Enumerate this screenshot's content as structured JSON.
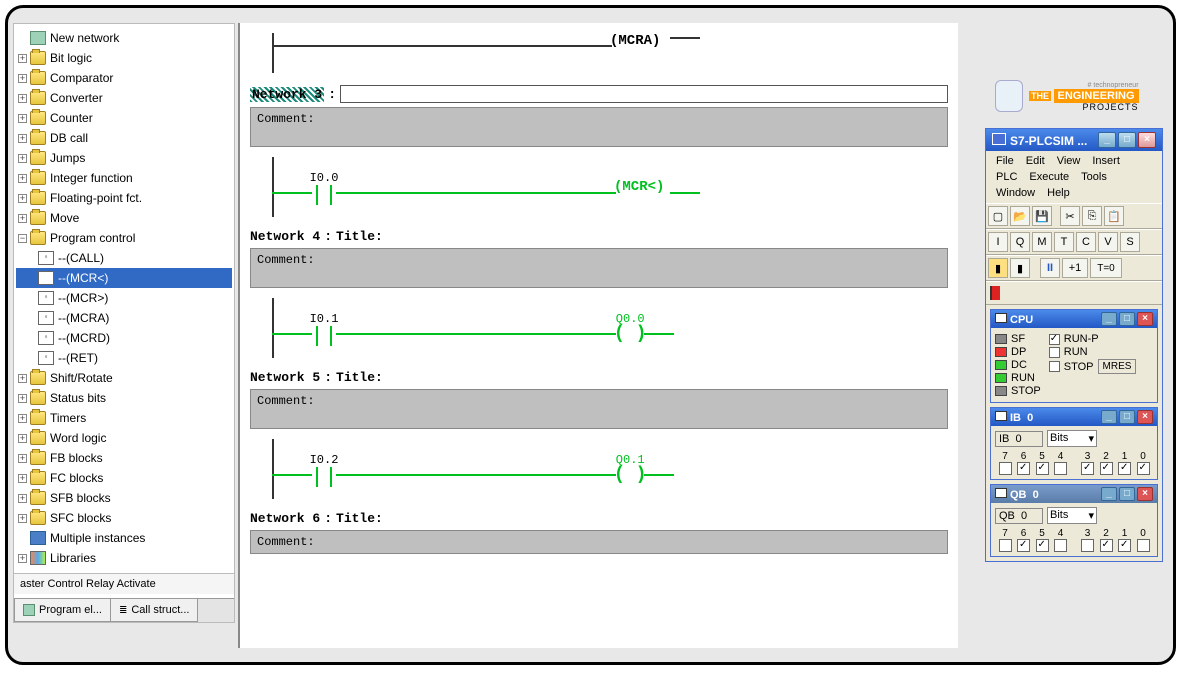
{
  "tree": {
    "items": [
      {
        "label": "New network",
        "icon": "prog",
        "indent": 0
      },
      {
        "label": "Bit logic",
        "icon": "folder",
        "indent": 0,
        "exp": "+"
      },
      {
        "label": "Comparator",
        "icon": "folder",
        "indent": 0,
        "exp": "+"
      },
      {
        "label": "Converter",
        "icon": "folder",
        "indent": 0,
        "exp": "+"
      },
      {
        "label": "Counter",
        "icon": "folder",
        "indent": 0,
        "exp": "+"
      },
      {
        "label": "DB call",
        "icon": "folder",
        "indent": 0,
        "exp": "+"
      },
      {
        "label": "Jumps",
        "icon": "folder",
        "indent": 0,
        "exp": "+"
      },
      {
        "label": "Integer function",
        "icon": "folder",
        "indent": 0,
        "exp": "+"
      },
      {
        "label": "Floating-point fct.",
        "icon": "folder",
        "indent": 0,
        "exp": "+"
      },
      {
        "label": "Move",
        "icon": "folder",
        "indent": 0,
        "exp": "+"
      },
      {
        "label": "Program control",
        "icon": "folder",
        "indent": 0,
        "exp": "−"
      },
      {
        "label": "--(CALL)",
        "icon": "element",
        "indent": 1
      },
      {
        "label": "--(MCR<)",
        "icon": "element",
        "indent": 1,
        "selected": true
      },
      {
        "label": "--(MCR>)",
        "icon": "element",
        "indent": 1
      },
      {
        "label": "--(MCRA)",
        "icon": "element",
        "indent": 1
      },
      {
        "label": "--(MCRD)",
        "icon": "element",
        "indent": 1
      },
      {
        "label": "--(RET)",
        "icon": "element",
        "indent": 1
      },
      {
        "label": "Shift/Rotate",
        "icon": "folder",
        "indent": 0,
        "exp": "+"
      },
      {
        "label": "Status bits",
        "icon": "folder",
        "indent": 0,
        "exp": "+"
      },
      {
        "label": "Timers",
        "icon": "folder",
        "indent": 0,
        "exp": "+"
      },
      {
        "label": "Word logic",
        "icon": "folder",
        "indent": 0,
        "exp": "+"
      },
      {
        "label": "FB blocks",
        "icon": "folder",
        "indent": 0,
        "exp": "+"
      },
      {
        "label": "FC blocks",
        "icon": "folder",
        "indent": 0,
        "exp": "+"
      },
      {
        "label": "SFB blocks",
        "icon": "folder",
        "indent": 0,
        "exp": "+"
      },
      {
        "label": "SFC blocks",
        "icon": "folder",
        "indent": 0,
        "exp": "+"
      },
      {
        "label": "Multiple instances",
        "icon": "blue",
        "indent": 0
      },
      {
        "label": "Libraries",
        "icon": "lib",
        "indent": 0,
        "exp": "+"
      }
    ],
    "status": "aster Control Relay Activate",
    "tabs": [
      "Program el...",
      "Call struct..."
    ]
  },
  "networks": {
    "n2_coil": "(MCRA)",
    "n3_label": "Network 3",
    "n3_comment": "Comment:",
    "n3_contact": "I0.0",
    "n3_coil": "(MCR<)",
    "n4_label": "Network 4",
    "n4_title": "Title:",
    "n4_comment": "Comment:",
    "n4_contact": "I0.1",
    "n4_coil_label": "Q0.0",
    "n5_label": "Network 5",
    "n5_title": "Title:",
    "n5_comment": "Comment:",
    "n5_contact": "I0.2",
    "n5_coil_label": "Q0.1",
    "n6_label": "Network 6",
    "n6_title": "Title:",
    "n6_comment": "Comment:"
  },
  "logo": {
    "top": "# technopreneur",
    "brand_the": "THE",
    "brand_eng": "ENGINEERING",
    "brand_proj": "PROJECTS"
  },
  "sim": {
    "title": "S7-PLCSIM ...",
    "menus": [
      "File",
      "Edit",
      "View",
      "Insert",
      "PLC",
      "Execute",
      "Tools",
      "Window",
      "Help"
    ],
    "tb2_pause": "II",
    "tb2_plus": "+1",
    "tb2_time": "T=0",
    "cpu": {
      "title": "CPU",
      "leds": [
        "SF",
        "DP",
        "DC",
        "RUN",
        "STOP"
      ],
      "runp": "RUN-P",
      "run": "RUN",
      "stop": "STOP",
      "mres": "MRES"
    },
    "ib": {
      "title": "IB",
      "title2": "0",
      "field": "IB",
      "addr": "0",
      "format": "Bits",
      "bits": [
        "7",
        "6",
        "5",
        "4",
        "3",
        "2",
        "1",
        "0"
      ],
      "checked": [
        false,
        true,
        true,
        false,
        true,
        true,
        true,
        true
      ]
    },
    "qb": {
      "title": "QB",
      "title2": "0",
      "field": "QB",
      "addr": "0",
      "format": "Bits",
      "bits": [
        "7",
        "6",
        "5",
        "4",
        "3",
        "2",
        "1",
        "0"
      ],
      "checked": [
        false,
        true,
        true,
        false,
        false,
        true,
        true,
        false
      ]
    }
  }
}
